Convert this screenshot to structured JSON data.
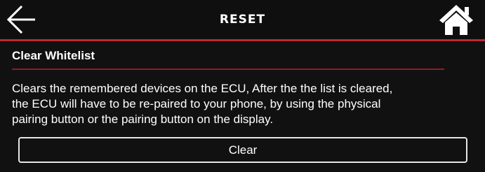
{
  "header": {
    "title": "RESET",
    "back_icon": "arrow-left-icon",
    "home_icon": "home-icon"
  },
  "section": {
    "title": "Clear Whitelist",
    "description_lines": [
      "Clears the remembered devices on the ECU, After the the list is cleared,",
      "the ECU will have to be re-paired to your phone, by using the physical",
      "pairing button or the pairing button on the display."
    ]
  },
  "actions": {
    "clear_label": "Clear"
  },
  "colors": {
    "background": "#111111",
    "accent_red": "#c0272d",
    "text": "#ffffff",
    "button_border": "#e6e6e6"
  }
}
